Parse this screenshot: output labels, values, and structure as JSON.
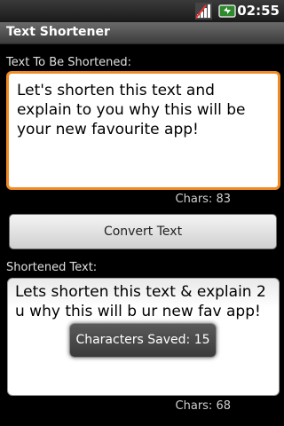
{
  "status_bar": {
    "time": "02:55"
  },
  "app": {
    "title": "Text Shortener"
  },
  "input": {
    "label": "Text To Be Shortened:",
    "value": "Let's shorten this text and explain to you why this will be your new favourite app!",
    "chars_label": "Chars: 83"
  },
  "convert_button": {
    "label": "Convert Text"
  },
  "output": {
    "label": "Shortened Text:",
    "value": "Lets shorten this text & explain 2 u why this will b ur new fav app!",
    "chars_label": "Chars: 68"
  },
  "toast": {
    "message": "Characters Saved: 15"
  },
  "colors": {
    "accent_focus": "#f08a24"
  },
  "icons": {
    "signal": "signal-bars-icon",
    "battery": "battery-icon"
  }
}
